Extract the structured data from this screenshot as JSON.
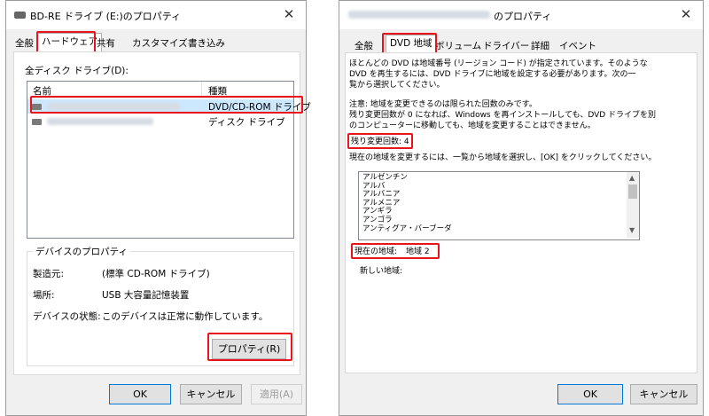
{
  "left": {
    "title": "BD-RE ドライブ (E:)のプロパティ",
    "tabs": [
      "全般",
      "ハードウェア",
      "共有",
      "カスタマイズ",
      "書き込み"
    ],
    "drives_label": "全ディスク ドライブ(D):",
    "columns": [
      "名前",
      "種類"
    ],
    "rows": [
      {
        "type": "DVD/CD-ROM ドライブ"
      },
      {
        "type": "ディスク ドライブ"
      }
    ],
    "device_props_label": "デバイスのプロパティ",
    "manufacturer_label": "製造元:",
    "manufacturer_value": "(標準 CD-ROM ドライブ)",
    "location_label": "場所:",
    "location_value": "USB 大容量記憶装置",
    "status_label": "デバイスの状態:",
    "status_value": "このデバイスは正常に動作しています。",
    "properties_button": "プロパティ(R)",
    "ok": "OK",
    "cancel": "キャンセル",
    "apply": "適用(A)"
  },
  "right": {
    "title_suffix": "のプロパティ",
    "tabs": [
      "全般",
      "DVD 地域",
      "ボリューム",
      "ドライバー",
      "詳細",
      "イベント"
    ],
    "intro_lines": [
      "ほとんどの DVD は地域番号 (リージョン コード) が指定されています。そのような",
      "DVD を再生するには、DVD ドライブに地域を設定する必要があります。次の一",
      "覧から選択してください。"
    ],
    "note_lines": [
      "注意: 地域を変更できるのは限られた回数のみです。",
      "残り変更回数が 0 になれば、Windows を再インストールしても、DVD ドライブを別",
      "のコンピューターに移動しても、地域を変更することはできません。"
    ],
    "remaining_changes": "残り変更回数: 4",
    "instruction": "現在の地域を変更するには、一覧から地域を選択し、[OK] をクリックしてください。",
    "regions": [
      "アルゼンチン",
      "アルバ",
      "アルバニア",
      "アルメニア",
      "アンギラ",
      "アンゴラ",
      "アンティグア・バーブーダ"
    ],
    "current_region_label": "現在の地域:",
    "current_region_value": "地域 2",
    "new_region_label": "新しい地域:",
    "ok": "OK",
    "cancel": "キャンセル"
  },
  "colors": {
    "highlight": "#e8141a",
    "accent": "#0078d7"
  }
}
